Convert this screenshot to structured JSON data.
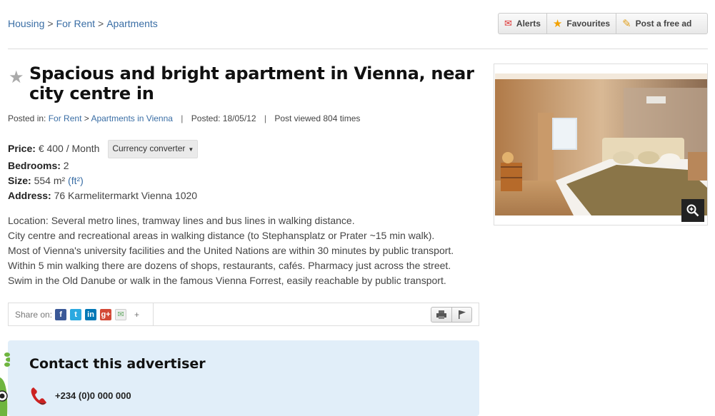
{
  "breadcrumb": {
    "items": [
      "Housing",
      "For Rent",
      "Apartments"
    ],
    "separator": ">"
  },
  "top_actions": {
    "alerts": "Alerts",
    "favourites": "Favourites",
    "post": "Post a free ad"
  },
  "listing": {
    "title": "Spacious and bright apartment in Vienna, near city centre in",
    "meta": {
      "posted_in_label": "Posted in:",
      "category": "For Rent",
      "subcategory": "Apartments in Vienna",
      "posted_label": "Posted: 18/05/12",
      "views": "Post viewed 804 times"
    },
    "price_label": "Price:",
    "price_value": "€ 400 / Month",
    "currency_converter": "Currency converter",
    "bedrooms_label": "Bedrooms:",
    "bedrooms_value": "2",
    "size_label": "Size:",
    "size_value": "554 m²",
    "size_unit_link": "(ft²)",
    "address_label": "Address:",
    "address_value": "76 Karmelitermarkt Vienna 1020",
    "description": [
      "Location: Several metro lines, tramway lines and bus lines in walking distance.",
      "City centre and recreational areas in walking distance (to Stephansplatz or Prater ~15 min walk).",
      "Most of Vienna's university facilities and the United Nations are within 30 minutes by public transport.",
      "Within 5 min walking there are dozens of shops, restaurants, cafés. Pharmacy just across the street.",
      "Swim in the Old Danube or walk in the famous Vienna Forrest, easily reachable by public transport."
    ]
  },
  "share": {
    "label": "Share on:",
    "more": "+",
    "icons": [
      "facebook-icon",
      "twitter-icon",
      "linkedin-icon",
      "google-plus-icon",
      "email-icon"
    ]
  },
  "contact": {
    "title": "Contact this advertiser",
    "phone": "+234 (0)0 000 000"
  },
  "colors": {
    "link": "#3a6ea5",
    "contact_bg": "#e1eef9"
  }
}
